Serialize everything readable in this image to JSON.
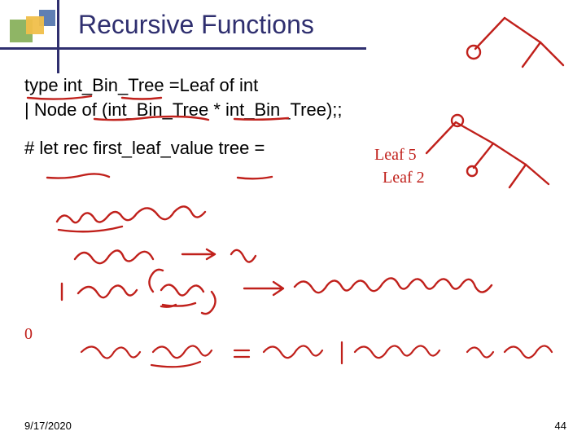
{
  "title": "Recursive Functions",
  "code": {
    "l1": "type int_Bin_Tree =Leaf of int",
    "l2": "| Node of (int_Bin_Tree * int_Bin_Tree);;",
    "l3": "# let rec first_leaf_value tree ="
  },
  "handwriting": {
    "h1": "match tree with",
    "h2": "Leaf n → n",
    "h3": "| Node (lt, rt) → first_leaf_value lt",
    "h4": "type MyList = NilList | MyConsOp int MyList",
    "side1": "Leaf 5",
    "side2": "Leaf 2",
    "zero": "0"
  },
  "footer": {
    "date": "9/17/2020",
    "page": "44"
  }
}
